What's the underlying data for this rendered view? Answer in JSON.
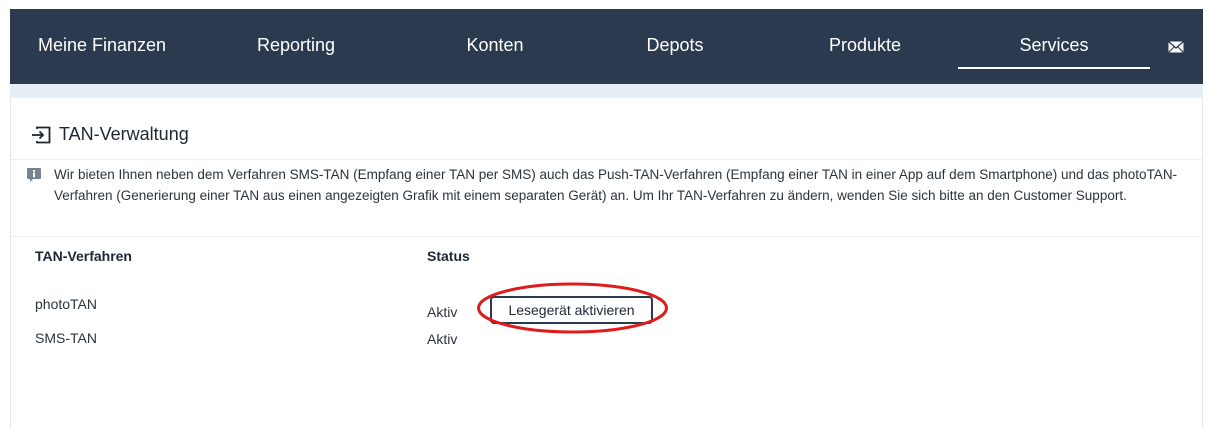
{
  "nav": {
    "items": [
      {
        "label": "Meine Finanzen"
      },
      {
        "label": "Reporting"
      },
      {
        "label": "Konten"
      },
      {
        "label": "Depots"
      },
      {
        "label": "Produkte"
      },
      {
        "label": "Services",
        "active": true
      }
    ],
    "mail_icon": "envelope-icon"
  },
  "panel": {
    "title": "TAN-Verwaltung",
    "title_icon": "login-icon",
    "info_icon": "info-icon",
    "info_text": "Wir bieten Ihnen neben dem Verfahren SMS-TAN (Empfang einer TAN per SMS) auch das Push-TAN-Verfahren (Empfang einer TAN in einer App auf dem Smartphone) und das photoTAN-Verfahren (Generierung einer TAN aus einen angezeigten Grafik mit einem separaten Gerät) an. Um Ihr TAN-Verfahren zu ändern, wenden Sie sich bitte an den Customer Support."
  },
  "table": {
    "headers": [
      "TAN-Verfahren",
      "Status"
    ],
    "rows": [
      {
        "method": "photoTAN",
        "status": "Aktiv",
        "action": "Lesegerät aktivieren"
      },
      {
        "method": "SMS-TAN",
        "status": "Aktiv"
      }
    ]
  },
  "colors": {
    "nav_bg": "#2b3a4e",
    "subbar_bg": "#e6eef6",
    "highlight": "#e01b1b"
  }
}
